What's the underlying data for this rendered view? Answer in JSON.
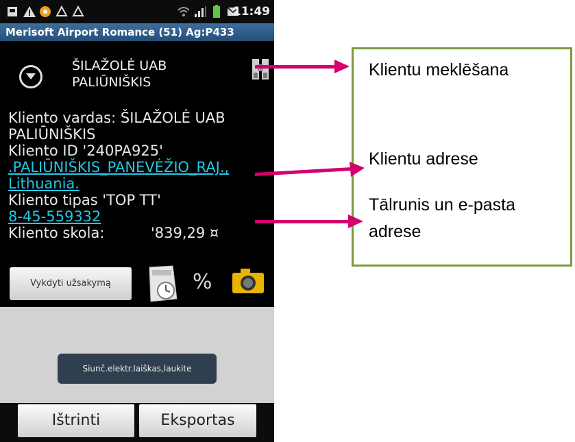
{
  "status_bar": {
    "time": "11:49",
    "icons": [
      "sd-card-icon",
      "warning-icon",
      "notification-dot-icon",
      "recycle-icon",
      "recycle-icon",
      "wifi-icon",
      "signal-icon",
      "battery-icon",
      "email-icon"
    ]
  },
  "app_title": "Merisoft Airport Romance (51) Ag:P433",
  "header": {
    "client_name_line1": "ŠILAŽOLĖ UAB",
    "client_name_line2": "PALIŪNIŠKIS"
  },
  "client_info": {
    "name_line1": "Kliento vardas: ŠILAŽOLĖ UAB",
    "name_line2": "PALIŪNIŠKIS",
    "id": "Kliento ID '240PA925'",
    "address_line1": ".PALIŪNIŠKIS_PANEVĖŽIO_RAJ.,",
    "address_line2": "Lithuania.",
    "type": "Kliento tipas 'TOP TT'",
    "phone": "8-45-559332",
    "debt_label": "Kliento skola:",
    "debt_value": "'839,29 ¤"
  },
  "actions": {
    "order_button": "Vykdyti užsakymą",
    "percent_label": "%"
  },
  "toast": "Siunč.elektr.laiškas,laukite",
  "bottom_buttons": {
    "delete": "Ištrinti",
    "export": "Eksportas"
  },
  "annotations": {
    "search": "Klientu meklēšana",
    "address": "Klientu adrese",
    "phone_email_line1": "Tālrunis un e-pasta",
    "phone_email_line2": "adrese"
  },
  "colors": {
    "arrow": "#d4006e",
    "callout_border": "#7a9a3a",
    "link": "#22c8e6",
    "title_bar": "#2f5f8c"
  }
}
